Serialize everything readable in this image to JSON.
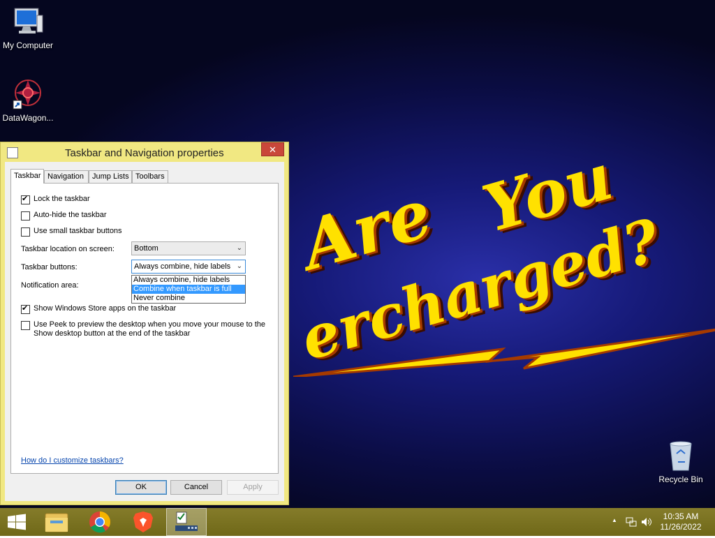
{
  "desktop": {
    "icons": [
      {
        "label": "My Computer",
        "icon": "computer-icon"
      },
      {
        "label": "DataWagon...",
        "icon": "datawagon-shortcut-icon"
      },
      {
        "label": "Recycle Bin",
        "icon": "recycle-bin-icon"
      }
    ],
    "wallpaper_text": [
      "Are",
      "You",
      "ercharged?"
    ]
  },
  "dialog": {
    "title": "Taskbar and Navigation properties",
    "close_label": "✕",
    "tabs": [
      {
        "label": "Taskbar",
        "active": true
      },
      {
        "label": "Navigation",
        "active": false
      },
      {
        "label": "Jump Lists",
        "active": false
      },
      {
        "label": "Toolbars",
        "active": false
      }
    ],
    "options": {
      "lock_taskbar": {
        "label": "Lock the taskbar",
        "checked": true
      },
      "auto_hide": {
        "label": "Auto-hide the taskbar",
        "checked": false
      },
      "small_buttons": {
        "label": "Use small taskbar buttons",
        "checked": false
      },
      "store_apps": {
        "label": "Show Windows Store apps on the taskbar",
        "checked": true
      },
      "peek": {
        "label_line1": "Use Peek to preview the desktop when you move your mouse to the",
        "label_line2": "Show desktop button at the end of the taskbar",
        "checked": false
      }
    },
    "location_label": "Taskbar location on screen:",
    "location_value": "Bottom",
    "buttons_label": "Taskbar buttons:",
    "buttons_value": "Always combine, hide labels",
    "buttons_options": [
      "Always combine, hide labels",
      "Combine when taskbar is full",
      "Never combine"
    ],
    "buttons_highlighted_index": 1,
    "notification_label": "Notification area:",
    "help_link": "How do I customize taskbars?",
    "ok_label": "OK",
    "cancel_label": "Cancel",
    "apply_label": "Apply"
  },
  "taskbar": {
    "items": [
      "start-button",
      "file-explorer",
      "chrome",
      "brave",
      "taskbar-properties"
    ],
    "clock_time": "10:35 AM",
    "clock_date": "11/26/2022",
    "tray_chevron": "▲"
  },
  "colors": {
    "dialog_frame": "#f1e882",
    "taskbar": "#7a7220",
    "selection": "#3399ff",
    "close_button": "#c9473a"
  }
}
